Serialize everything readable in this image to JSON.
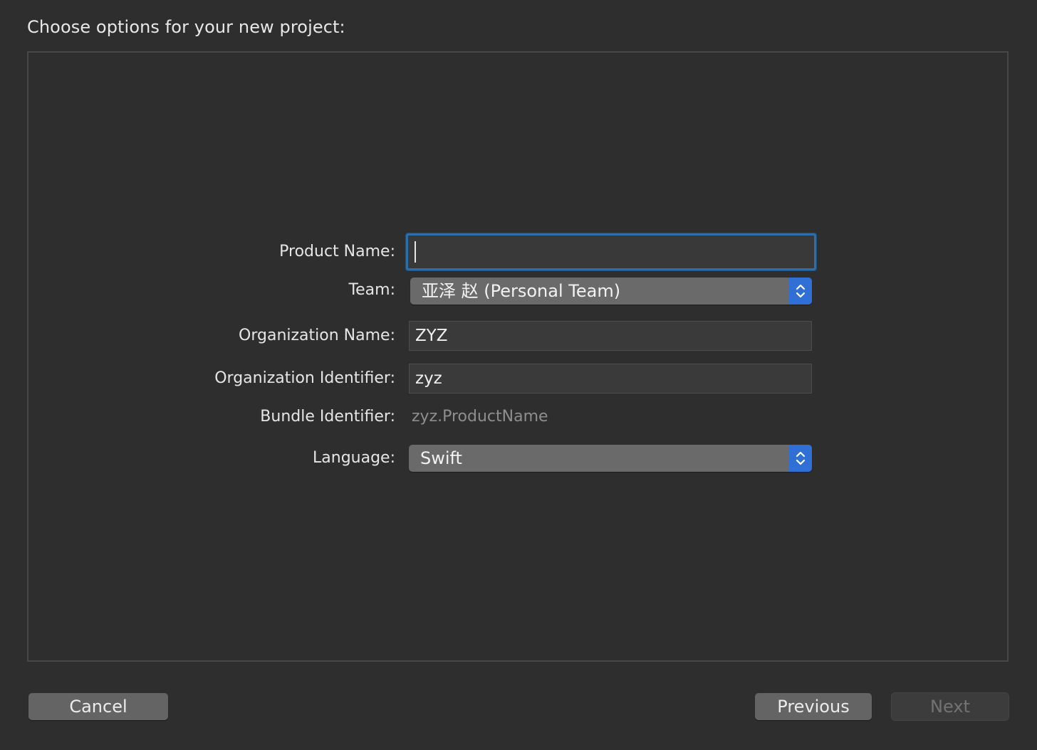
{
  "dialog": {
    "heading": "Choose options for your new project:"
  },
  "form": {
    "product_name": {
      "label": "Product Name:",
      "value": ""
    },
    "team": {
      "label": "Team:",
      "selected": "亚泽 赵 (Personal Team)"
    },
    "organization_name": {
      "label": "Organization Name:",
      "value": "ZYZ"
    },
    "organization_identifier": {
      "label": "Organization Identifier:",
      "value": "zyz"
    },
    "bundle_identifier": {
      "label": "Bundle Identifier:",
      "value": "zyz.ProductName"
    },
    "language": {
      "label": "Language:",
      "selected": "Swift"
    }
  },
  "buttons": {
    "cancel": "Cancel",
    "previous": "Previous",
    "next": "Next"
  },
  "colors": {
    "background": "#2e2e2e",
    "focus_ring": "#2b6eab",
    "popup_accent": "#2f6fd6"
  },
  "icons": {
    "popup_stepper": "chevron-up-down-icon"
  }
}
